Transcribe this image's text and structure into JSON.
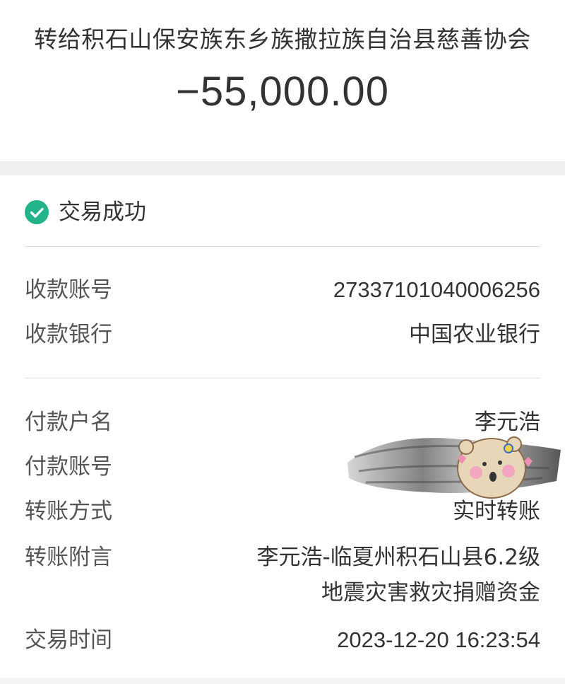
{
  "header": {
    "recipient_title": "转给积石山保安族东乡族撒拉族自治县慈善协会",
    "amount": "−55,000.00"
  },
  "status": {
    "text": "交易成功",
    "icon": "check-circle-icon",
    "color": "#22b38a"
  },
  "details": {
    "payee_account": {
      "label": "收款账号",
      "value": "27337101040006256"
    },
    "payee_bank": {
      "label": "收款银行",
      "value": "中国农业银行"
    },
    "payer_name": {
      "label": "付款户名",
      "value": "李元浩"
    },
    "payer_account": {
      "label": "付款账号",
      "value": ""
    },
    "transfer_method": {
      "label": "转账方式",
      "value": "实时转账"
    },
    "transfer_note": {
      "label": "转账附言",
      "value_line1": "李元浩-临夏州积石山县6.2级",
      "value_line2": "地震灾害救灾捐赠资金"
    },
    "transaction_time": {
      "label": "交易时间",
      "value": "2023-12-20 16:23:54"
    }
  }
}
